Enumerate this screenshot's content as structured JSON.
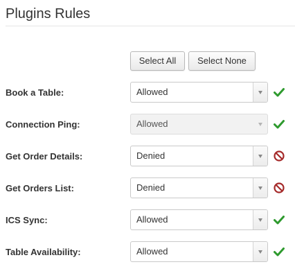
{
  "page": {
    "title": "Plugins Rules"
  },
  "toolbar": {
    "select_all_label": "Select All",
    "select_none_label": "Select None"
  },
  "rules": [
    {
      "label": "Book a Table:",
      "value": "Allowed",
      "status_icon": "check-icon",
      "disabled": false
    },
    {
      "label": "Connection Ping:",
      "value": "Allowed",
      "status_icon": "check-icon",
      "disabled": true
    },
    {
      "label": "Get Order Details:",
      "value": "Denied",
      "status_icon": "prohibited-icon",
      "disabled": false
    },
    {
      "label": "Get Orders List:",
      "value": "Denied",
      "status_icon": "prohibited-icon",
      "disabled": false
    },
    {
      "label": "ICS Sync:",
      "value": "Allowed",
      "status_icon": "check-icon",
      "disabled": false
    },
    {
      "label": "Table Availability:",
      "value": "Allowed",
      "status_icon": "check-icon",
      "disabled": false
    }
  ],
  "colors": {
    "allowed": "#2e9a2e",
    "denied": "#a52a2a",
    "text": "#333333"
  }
}
